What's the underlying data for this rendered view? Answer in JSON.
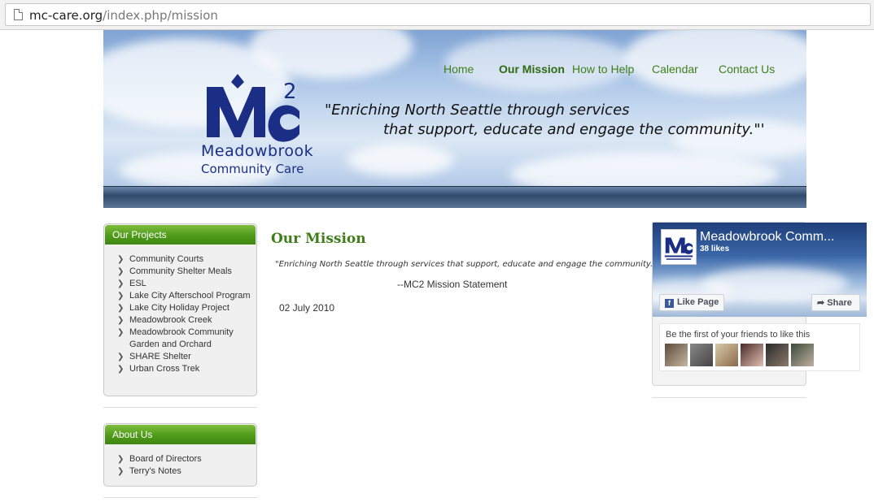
{
  "browser": {
    "url_domain": "mc-care.org",
    "url_path": "/index.php/mission"
  },
  "nav": {
    "items": [
      {
        "label": "Home",
        "active": false
      },
      {
        "label": "Our Mission",
        "active": true
      },
      {
        "label": "How to Help",
        "active": false
      },
      {
        "label": "Calendar",
        "active": false
      },
      {
        "label": "Contact Us",
        "active": false
      }
    ]
  },
  "header": {
    "logo_mark": "MC2",
    "logo_name": "Meadowbrook",
    "logo_sub": "Community Care",
    "tagline_line1": "\"Enriching North Seattle through services",
    "tagline_line2": "that support, educate and engage the community.\"'"
  },
  "sidebar": {
    "projects": {
      "title": "Our Projects",
      "items": [
        "Community Courts",
        "Community Shelter Meals",
        "ESL",
        "Lake City Afterschool Program",
        "Lake City Holiday Project",
        "Meadowbrook Creek",
        "Meadowbrook Community Garden and Orchard",
        "SHARE Shelter",
        "Urban Cross Trek"
      ]
    },
    "about": {
      "title": "About Us",
      "items": [
        "Board of Directors",
        "Terry's Notes"
      ]
    }
  },
  "main": {
    "title": "Our Mission",
    "quote": "\"Enriching North Seattle through services that support, educate and engage the community.\"",
    "attribution": "--MC2 Mission Statement",
    "date": "02 July 2010"
  },
  "facebook": {
    "page_name": "Meadowbrook Comm...",
    "likes": "38 likes",
    "like_button": "Like Page",
    "share_button": "Share",
    "friends_text": "Be the first of your friends to like this"
  },
  "colors": {
    "nav_green": "#3f7e1a",
    "header_green": "#4f9a1a",
    "logo_blue": "#1a2e86",
    "facebook_blue": "#3b5998"
  }
}
